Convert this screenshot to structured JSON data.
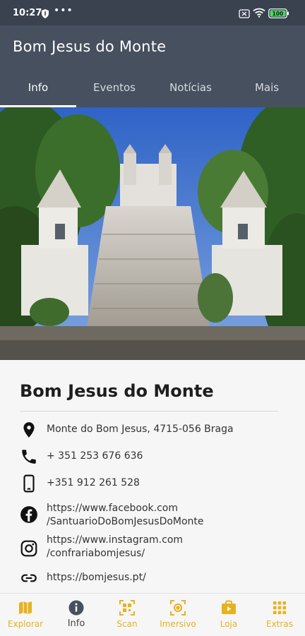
{
  "status": {
    "time": "10:27",
    "battery": "100"
  },
  "header": {
    "title": "Bom Jesus do Monte"
  },
  "tabs": [
    {
      "label": "Info",
      "active": true
    },
    {
      "label": "Eventos"
    },
    {
      "label": "Notícias"
    },
    {
      "label": "Mais"
    }
  ],
  "place": {
    "title": "Bom Jesus do Monte",
    "address": "Monte do Bom Jesus, 4715-056 Braga",
    "phone": "+ 351 253 676 636",
    "mobile": "+351 912 261 528",
    "facebook_line1": "https://www.facebook.com",
    "facebook_line2": "/SantuarioDoBomJesusDoMonte",
    "instagram_line1": "https://www.instagram.com",
    "instagram_line2": "/confrariabomjesus/",
    "website": "https://bomjesus.pt/"
  },
  "nav": [
    {
      "label": "Explorar",
      "icon": "map-icon"
    },
    {
      "label": "Info",
      "icon": "info-icon",
      "active": true
    },
    {
      "label": "Scan",
      "icon": "qr-scan-icon"
    },
    {
      "label": "Imersivo",
      "icon": "immersive-icon"
    },
    {
      "label": "Loja",
      "icon": "shop-bag-icon"
    },
    {
      "label": "Extras",
      "icon": "grid-icon"
    }
  ],
  "colors": {
    "app_bar": "#46505f",
    "status_bar": "#3a4250",
    "accent": "#e8b21c"
  }
}
